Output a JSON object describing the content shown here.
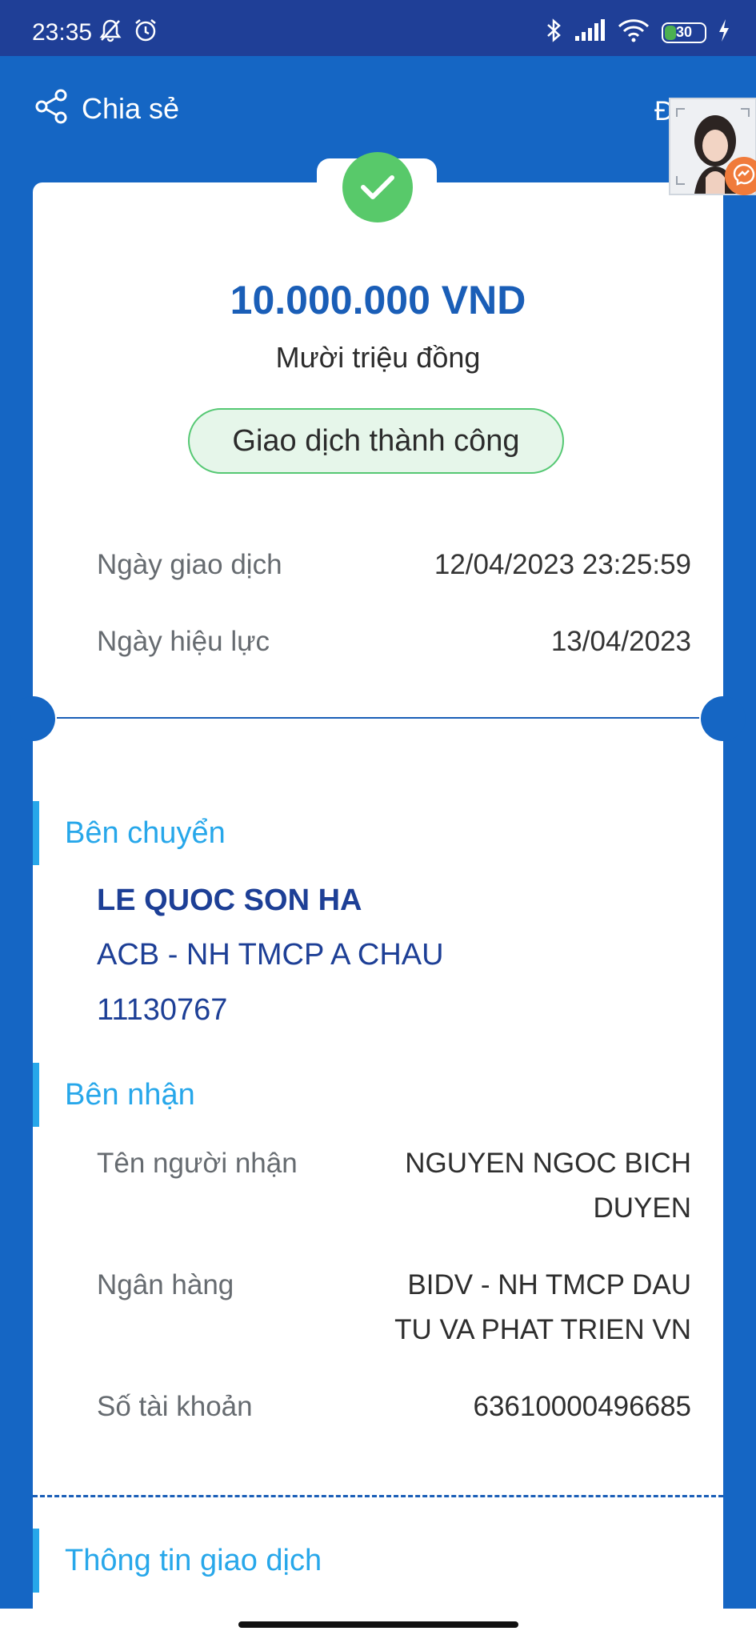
{
  "status_bar": {
    "time": "23:35",
    "left_icons": [
      "bell-off-icon",
      "alarm-icon"
    ],
    "right_icons": [
      "bluetooth-icon",
      "signal-icon",
      "wifi-icon"
    ],
    "battery_level": "30",
    "battery_fraction": 0.3
  },
  "header": {
    "share_label": "Chia sẻ",
    "right_label": "Đ"
  },
  "transaction": {
    "amount": "10.000.000 VND",
    "amount_words": "Mười triệu đồng",
    "status": "Giao dịch thành công",
    "rows": [
      {
        "label": "Ngày giao dịch",
        "value": "12/04/2023 23:25:59"
      },
      {
        "label": "Ngày hiệu lực",
        "value": "13/04/2023"
      }
    ]
  },
  "sender": {
    "title": "Bên chuyển",
    "name": "LE QUOC SON HA",
    "bank": "ACB - NH TMCP A CHAU",
    "account": "11130767"
  },
  "receiver": {
    "title": "Bên nhận",
    "rows": [
      {
        "label": "Tên người nhận",
        "value_lines": [
          "NGUYEN NGOC BICH",
          "DUYEN"
        ]
      },
      {
        "label": "Ngân hàng",
        "value_lines": [
          "BIDV - NH TMCP DAU",
          "TU VA PHAT TRIEN VN"
        ]
      },
      {
        "label": "Số tài khoản",
        "value_lines": [
          "63610000496685"
        ]
      }
    ]
  },
  "details": {
    "title": "Thông tin giao dịch"
  },
  "colors": {
    "primary": "#1566c4",
    "amount": "#1a5eb7",
    "section": "#27a7ea",
    "success": "#58c96a"
  }
}
